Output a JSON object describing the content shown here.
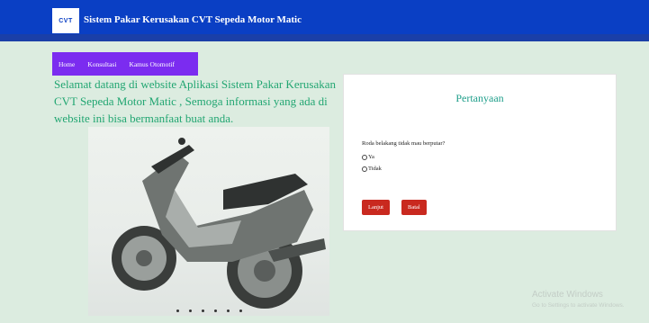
{
  "header": {
    "logo_text": "CVT",
    "title": "Sistem Pakar Kerusakan CVT Sepeda Motor Matic",
    "bg_color": "#0a3fc4"
  },
  "nav": {
    "items": [
      "Home",
      "Konsultasi",
      "Kamus Otomotif"
    ],
    "bg_color": "#7b2cf0"
  },
  "welcome_text": "Selamat datang di website Aplikasi Sistem Pakar Kerusakan CVT Sepeda Motor Matic , Semoga informasi yang ada di website ini bisa bermanfaat buat anda.",
  "hero": {
    "image": "scooter-photo",
    "slide_count": 6
  },
  "question_card": {
    "title": "Pertanyaan",
    "question": "Roda belakang tidak mau berputar?",
    "options": [
      "Ya",
      "Tidak"
    ],
    "next_label": "Lanjut",
    "cancel_label": "Batal",
    "button_color": "#c9291f"
  },
  "watermark": {
    "title": "Activate Windows",
    "subtitle": "Go to Settings to activate Windows."
  }
}
